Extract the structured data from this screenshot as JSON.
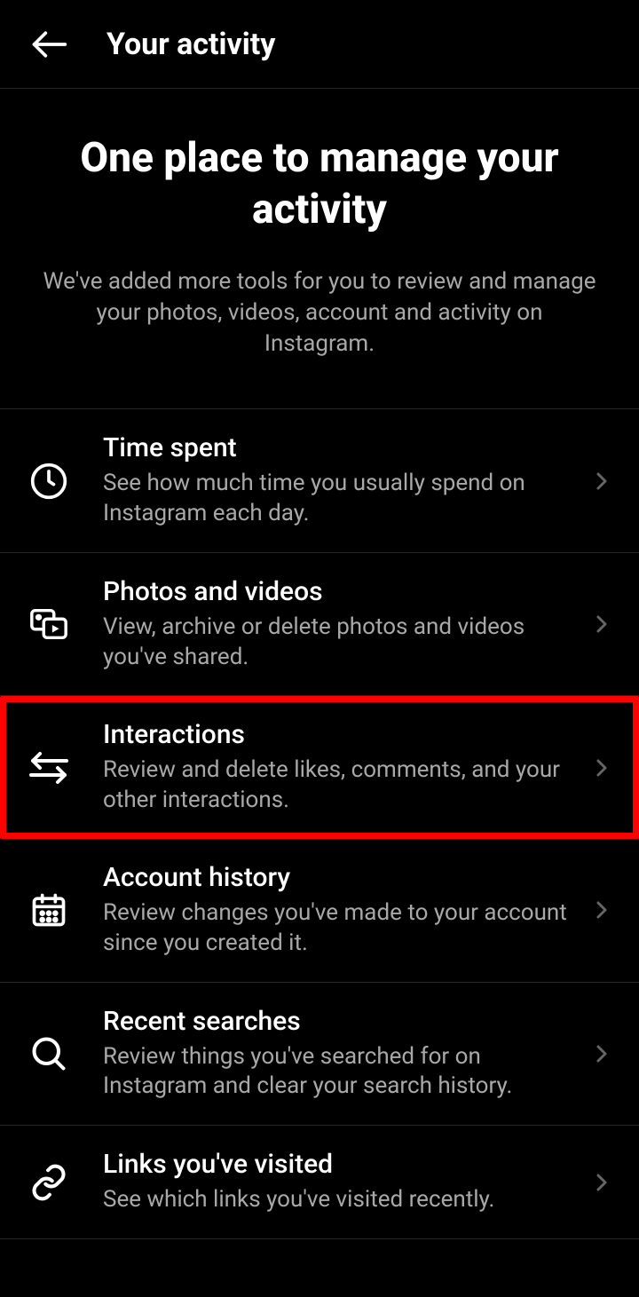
{
  "header": {
    "title": "Your activity"
  },
  "intro": {
    "heading": "One place to manage your activity",
    "sub": "We've added more tools for you to review and manage your photos, videos, account and activity on Instagram."
  },
  "items": [
    {
      "title": "Time spent",
      "desc": "See how much time you usually spend on Instagram each day."
    },
    {
      "title": "Photos and videos",
      "desc": "View, archive or delete photos and videos you've shared."
    },
    {
      "title": "Interactions",
      "desc": "Review and delete likes, comments, and your other interactions."
    },
    {
      "title": "Account history",
      "desc": "Review changes you've made to your account since you created it."
    },
    {
      "title": "Recent searches",
      "desc": "Review things you've searched for on Instagram and clear your search history."
    },
    {
      "title": "Links you've visited",
      "desc": "See which links you've visited recently."
    }
  ]
}
